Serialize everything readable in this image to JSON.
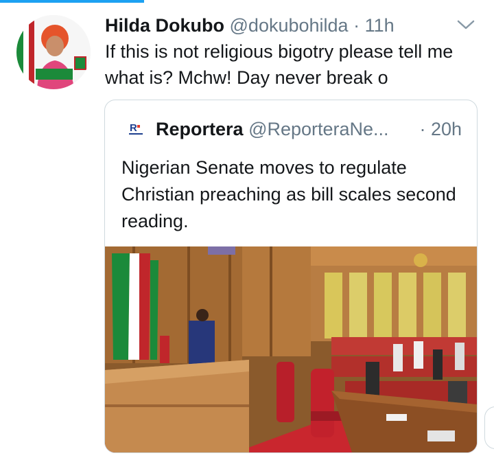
{
  "tweet": {
    "author_name": "Hilda Dokubo",
    "author_handle": "@dokubohilda",
    "separator": "·",
    "time": "11h",
    "text": "If this is not religious bigotry please tell me what is? Mchw! Day never break o"
  },
  "quoted": {
    "author_name": "Reportera",
    "author_handle": "@ReporteraNe...",
    "time": "· 20h",
    "text": "Nigerian Senate moves to regulate Christian preaching as bill scales second reading."
  },
  "icons": {
    "menu": "chevron-down-icon",
    "quoted_logo": "reportera-logo"
  },
  "colors": {
    "accent": "#1da1f2",
    "secondary_text": "#657786",
    "border": "#cfd9de",
    "senate_red": "#c0262b"
  }
}
